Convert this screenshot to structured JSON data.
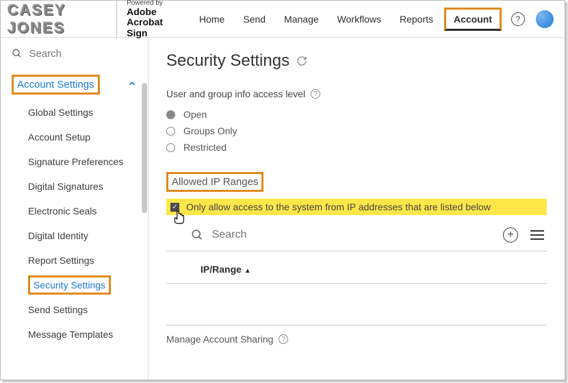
{
  "header": {
    "logo_text": "CASEY JONES",
    "powered_small": "Powered by",
    "powered_line1": "Adobe",
    "powered_line2": "Acrobat Sign",
    "nav": [
      "Home",
      "Send",
      "Manage",
      "Workflows",
      "Reports",
      "Account"
    ]
  },
  "sidebar": {
    "search_placeholder": "Search",
    "section_title": "Account Settings",
    "items": [
      "Global Settings",
      "Account Setup",
      "Signature Preferences",
      "Digital Signatures",
      "Electronic Seals",
      "Digital Identity",
      "Report Settings",
      "Security Settings",
      "Send Settings",
      "Message Templates"
    ]
  },
  "main": {
    "title": "Security Settings",
    "access_level_label": "User and group info access level",
    "radios": [
      "Open",
      "Groups Only",
      "Restricted"
    ],
    "allowed_ip_heading": "Allowed IP Ranges",
    "ip_checkbox_label": "Only allow access to the system from IP addresses that are listed below",
    "ip_search_placeholder": "Search",
    "table_column": "IP/Range",
    "manage_sharing_label": "Manage Account Sharing"
  },
  "highlight_color": "#e08a1b"
}
